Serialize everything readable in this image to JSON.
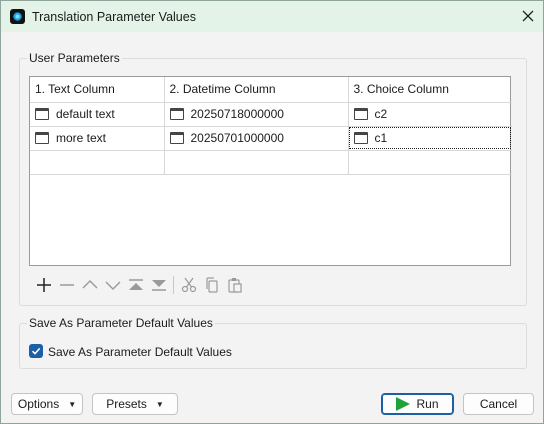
{
  "window": {
    "title": "Translation Parameter Values"
  },
  "user_parameters": {
    "group_title": "User Parameters",
    "columns": [
      "1. Text Column",
      "2. Datetime Column",
      "3. Choice Column"
    ],
    "rows": [
      [
        "default text",
        "20250718000000",
        "c2"
      ],
      [
        "more text",
        "20250701000000",
        "c1"
      ]
    ]
  },
  "toolbar": {
    "icons": [
      "plus-icon",
      "minus-icon",
      "move-up-icon",
      "move-down-icon",
      "move-top-icon",
      "move-bottom-icon",
      "cut-icon",
      "copy-icon",
      "paste-icon"
    ]
  },
  "save_defaults": {
    "group_title": "Save As Parameter Default Values",
    "checkbox_label": "Save As Parameter Default Values",
    "checked": true
  },
  "footer": {
    "options_label": "Options",
    "presets_label": "Presets",
    "run_label": "Run",
    "cancel_label": "Cancel"
  },
  "colors": {
    "titlebar": "#e3f3e7",
    "accent": "#1b5fa8",
    "run_green": "#1ea33a"
  }
}
